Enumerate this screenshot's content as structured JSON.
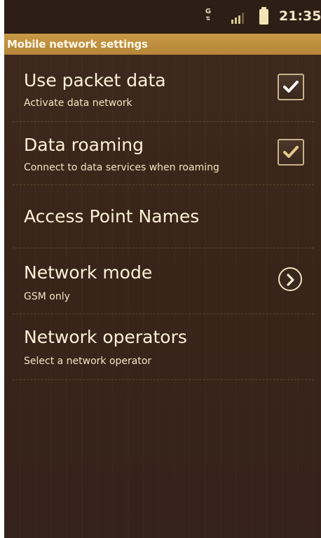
{
  "status_bar": {
    "network_type": "G",
    "time": "21:35",
    "icons": [
      "network-type-icon",
      "signal-icon",
      "battery-icon"
    ]
  },
  "header": {
    "title": "Mobile network settings"
  },
  "settings": [
    {
      "title": "Use packet data",
      "summary": "Activate data network",
      "widget": "checkbox",
      "checked": true
    },
    {
      "title": "Data roaming",
      "summary": "Connect to data services when roaming",
      "widget": "checkbox",
      "checked": true
    },
    {
      "title": "Access Point Names",
      "summary": "",
      "widget": "none"
    },
    {
      "title": "Network mode",
      "summary": "GSM only",
      "widget": "chevron-right-icon"
    },
    {
      "title": "Network operators",
      "summary": "Select a network operator",
      "widget": "none"
    }
  ],
  "colors": {
    "background": "#3a2519",
    "title_bar": "#c89a45",
    "text": "#fbf1d6",
    "checkmark": "#ffffff",
    "checkmark_dim": "#e3c98a"
  }
}
